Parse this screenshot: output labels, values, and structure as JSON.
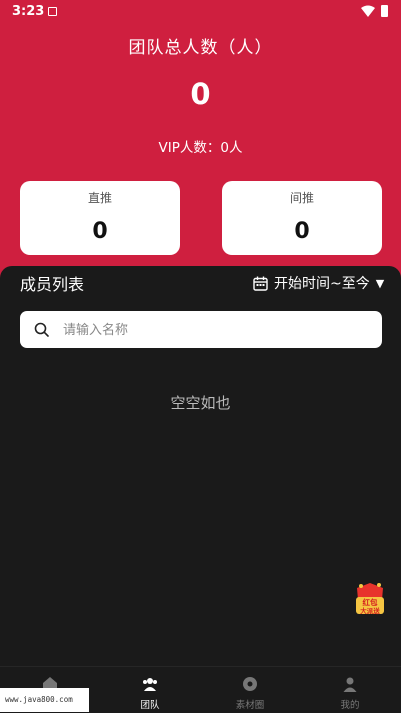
{
  "status_bar": {
    "time": "3:23"
  },
  "header": {
    "title": "团队总人数（人）",
    "total": "0",
    "vip_line": "VIP人数：0人"
  },
  "cards": [
    {
      "label": "直推",
      "value": "0"
    },
    {
      "label": "间推",
      "value": "0"
    }
  ],
  "members": {
    "title": "成员列表",
    "date_filter": "开始时间~至今",
    "search_placeholder": "请输入名称",
    "empty_text": "空空如也"
  },
  "floating_badge": {
    "lines": [
      "红包",
      "大派送"
    ]
  },
  "tabbar": {
    "items": [
      {
        "label": "",
        "icon": "home-icon",
        "active": false
      },
      {
        "label": "团队",
        "icon": "team-icon",
        "active": true
      },
      {
        "label": "素材圈",
        "icon": "chat-icon",
        "active": false
      },
      {
        "label": "我的",
        "icon": "profile-icon",
        "active": false
      }
    ]
  },
  "watermark": "www.java800.com",
  "colors": {
    "accent": "#cf1f3f",
    "background": "#1a1a1a",
    "badge": "#e8332c"
  }
}
